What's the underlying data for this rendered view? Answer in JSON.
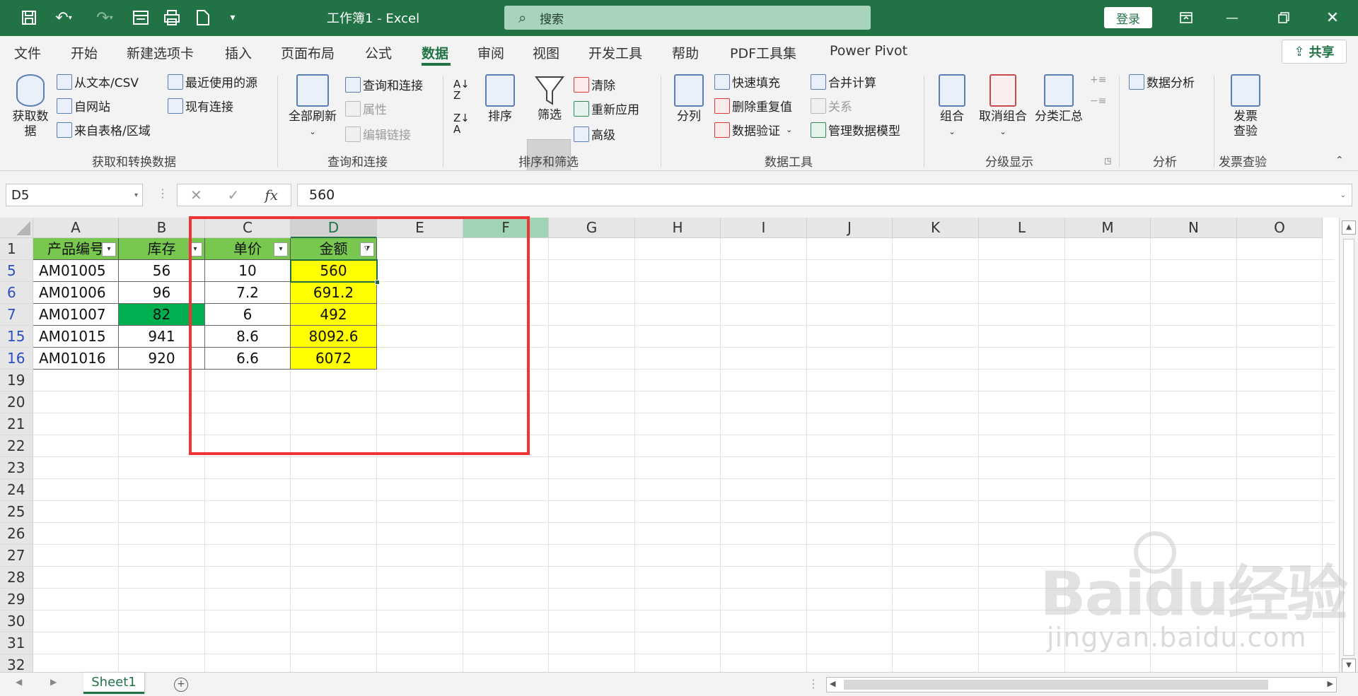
{
  "titlebar": {
    "doc_title": "工作簿1  -  Excel",
    "search_placeholder": "搜索",
    "login": "登录",
    "icons": [
      "save-icon",
      "undo-icon",
      "redo-icon",
      "form-icon",
      "print-preview-icon",
      "export-icon",
      "customize-qat-icon"
    ],
    "win_icons": [
      "ribbon-display-icon",
      "minimize-icon",
      "restore-icon",
      "close-icon"
    ]
  },
  "menu": {
    "items": [
      "文件",
      "开始",
      "新建选项卡",
      "插入",
      "页面布局",
      "公式",
      "数据",
      "审阅",
      "视图",
      "开发工具",
      "帮助",
      "PDF工具集",
      "Power Pivot"
    ],
    "active": "数据",
    "share": "共享"
  },
  "ribbon": {
    "get_data": {
      "big": "获取数\n据",
      "from_text": "从文本/CSV",
      "from_web": "自网站",
      "from_table": "来自表格/区域",
      "recent": "最近使用的源",
      "existing": "现有连接",
      "group_label": "获取和转换数据"
    },
    "queries": {
      "refresh_all": "全部刷新",
      "queries_conn": "查询和连接",
      "properties": "属性",
      "edit_links": "编辑链接",
      "group_label": "查询和连接"
    },
    "sort_filter": {
      "sort": "排序",
      "filter": "筛选",
      "clear": "清除",
      "reapply": "重新应用",
      "advanced": "高级",
      "group_label": "排序和筛选"
    },
    "data_tools": {
      "split": "分列",
      "flash_fill": "快速填充",
      "remove_dup": "删除重复值",
      "validation": "数据验证",
      "consolidate": "合并计算",
      "relations": "关系",
      "data_model": "管理数据模型",
      "group_label": "数据工具"
    },
    "outline": {
      "group": "组合",
      "ungroup": "取消组合",
      "subtotal": "分类汇总",
      "group_label": "分级显示"
    },
    "analysis": {
      "data_analysis": "数据分析",
      "group_label": "分析"
    },
    "invoice": {
      "check": "发票\n查验",
      "group_label": "发票查验"
    }
  },
  "formula_bar": {
    "name_box": "D5",
    "fx": "fx",
    "value": "560"
  },
  "sheet": {
    "columns": [
      "A",
      "B",
      "C",
      "D",
      "E",
      "F",
      "G",
      "H",
      "I",
      "J",
      "K",
      "L",
      "M",
      "N",
      "O"
    ],
    "rows": [
      "1",
      "5",
      "6",
      "7",
      "15",
      "16",
      "19",
      "20",
      "21",
      "22",
      "23",
      "24",
      "25",
      "26",
      "27",
      "28",
      "29",
      "30",
      "31",
      "32"
    ],
    "headers": [
      "产品编号",
      "库存",
      "单价",
      "金额"
    ],
    "data": [
      [
        "AM01005",
        "56",
        "10",
        "560"
      ],
      [
        "AM01006",
        "96",
        "7.2",
        "691.2"
      ],
      [
        "AM01007",
        "82",
        "6",
        "492"
      ],
      [
        "AM01015",
        "941",
        "8.6",
        "8092.6"
      ],
      [
        "AM01016",
        "920",
        "6.6",
        "6072"
      ]
    ],
    "colors": {
      "header_fill": "#78c850",
      "amount_fill": "#ffff00",
      "highlight_fill": "#00b050",
      "annotation": "#ee3535"
    }
  },
  "bottom": {
    "sheet_tab": "Sheet1",
    "add_sheet": "+"
  },
  "watermark": {
    "brand": "Baidu经验",
    "url": "jingyan.baidu.com"
  }
}
